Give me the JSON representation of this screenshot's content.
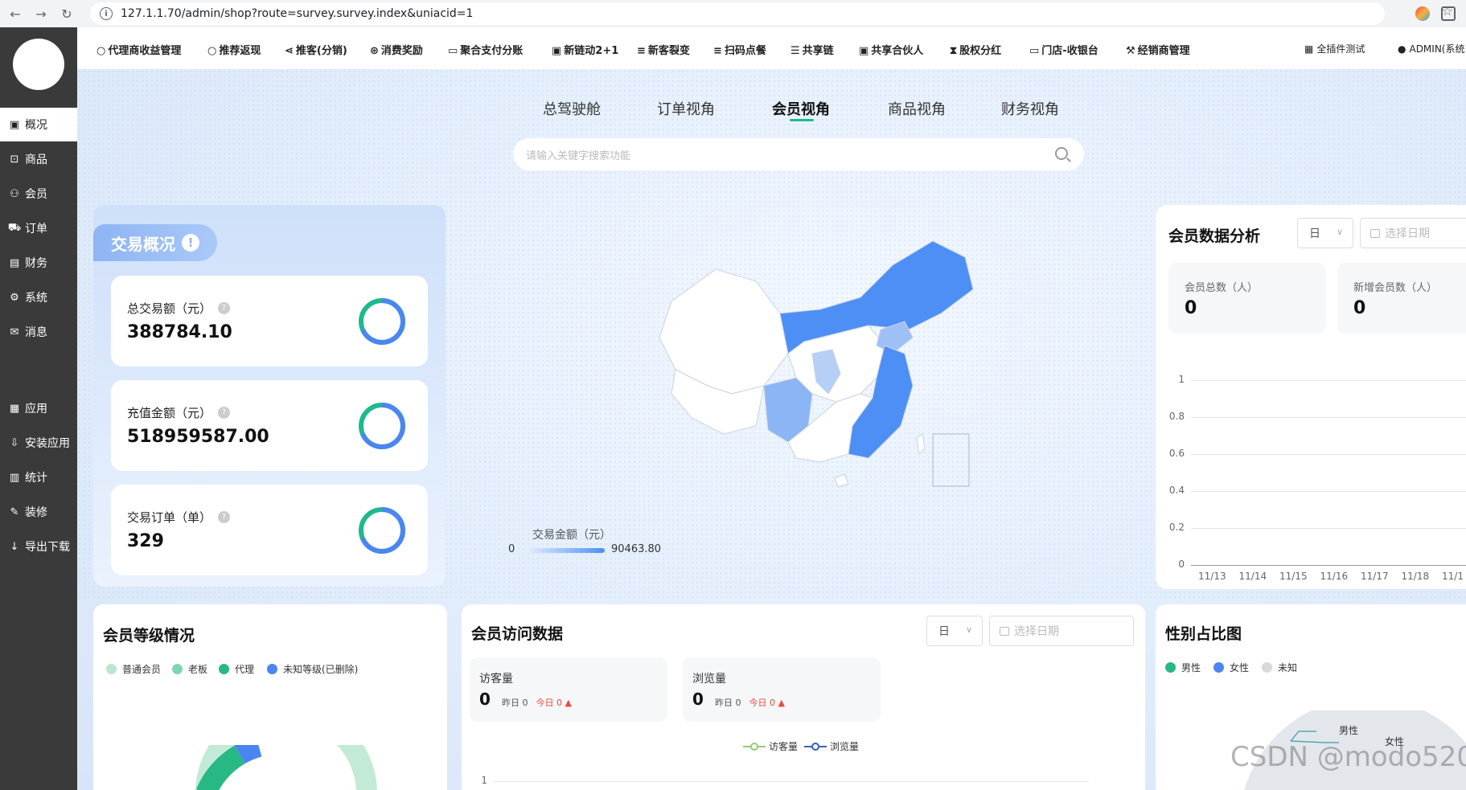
{
  "browser": {
    "url": "127.1.1.70/admin/shop?route=survey.survey.index&uniacid=1"
  },
  "sidebar": {
    "items": [
      {
        "label": "概况",
        "icon": "chart-icon"
      },
      {
        "label": "商品",
        "icon": "shop-icon"
      },
      {
        "label": "会员",
        "icon": "users-icon"
      },
      {
        "label": "订单",
        "icon": "cart-icon"
      },
      {
        "label": "财务",
        "icon": "wallet-icon"
      },
      {
        "label": "系统",
        "icon": "gear-icon"
      },
      {
        "label": "消息",
        "icon": "message-icon"
      },
      {
        "label": "应用",
        "icon": "apps-icon"
      },
      {
        "label": "安装应用",
        "icon": "install-icon"
      },
      {
        "label": "统计",
        "icon": "stats-icon"
      },
      {
        "label": "装修",
        "icon": "brush-icon"
      },
      {
        "label": "导出下载",
        "icon": "download-icon"
      }
    ]
  },
  "topmenu": {
    "items": [
      "代理商收益管理",
      "推荐返现",
      "推客(分销)",
      "消费奖励",
      "聚合支付分账",
      "新链动2+1",
      "新客裂变",
      "扫码点餐",
      "共享链",
      "共享合伙人",
      "股权分红",
      "门店-收银台",
      "经销商管理"
    ],
    "right": [
      "全插件测试",
      "ADMIN(系统"
    ]
  },
  "view_tabs": {
    "items": [
      "总驾驶舱",
      "订单视角",
      "会员视角",
      "商品视角",
      "财务视角"
    ],
    "active": "会员视角"
  },
  "search": {
    "placeholder": "请输入关键字搜索功能"
  },
  "transaction": {
    "title": "交易概况",
    "info_glyph": "!",
    "items": [
      {
        "label": "总交易额（元）",
        "value": "388784.10"
      },
      {
        "label": "充值金额（元）",
        "value": "518959587.00"
      },
      {
        "label": "交易订单（单）",
        "value": "329"
      }
    ]
  },
  "map": {
    "legend_title": "交易金额（元）",
    "legend_min": "0",
    "legend_max": "90463.80"
  },
  "member_data": {
    "title": "会员数据分析",
    "period": "日",
    "date_placeholder": "选择日期",
    "stats": [
      {
        "label": "会员总数（人）",
        "value": "0"
      },
      {
        "label": "新增会员数（人）",
        "value": "0"
      }
    ],
    "yticks": [
      "1",
      "0.8",
      "0.6",
      "0.4",
      "0.2",
      "0"
    ],
    "xticks": [
      "11/13",
      "11/14",
      "11/15",
      "11/16",
      "11/17",
      "11/18",
      "11/1"
    ]
  },
  "member_level": {
    "title": "会员等级情况",
    "legend": [
      {
        "name": "普通会员",
        "color": "#b8e8cf"
      },
      {
        "name": "老板",
        "color": "#7fd6ae"
      },
      {
        "name": "代理",
        "color": "#28b884"
      },
      {
        "name": "未知等级(已删除)",
        "color": "#4a86f0"
      }
    ]
  },
  "visits": {
    "title": "会员访问数据",
    "period": "日",
    "date_placeholder": "选择日期",
    "boxes": [
      {
        "label": "访客量",
        "value": "0",
        "yesterday": "昨日 0",
        "today": "今日 0 ▲"
      },
      {
        "label": "浏览量",
        "value": "0",
        "yesterday": "昨日 0",
        "today": "今日 0 ▲"
      }
    ],
    "legend": [
      "访客量",
      "浏览量"
    ],
    "ytick_top": "1"
  },
  "gender": {
    "title": "性别占比图",
    "legend": [
      {
        "name": "男性",
        "color": "#28b884"
      },
      {
        "name": "女性",
        "color": "#4a86f0"
      },
      {
        "name": "未知",
        "color": "#d9d9d9"
      }
    ],
    "labels": [
      "男性",
      "女性"
    ]
  },
  "watermark": "CSDN @modo520"
}
